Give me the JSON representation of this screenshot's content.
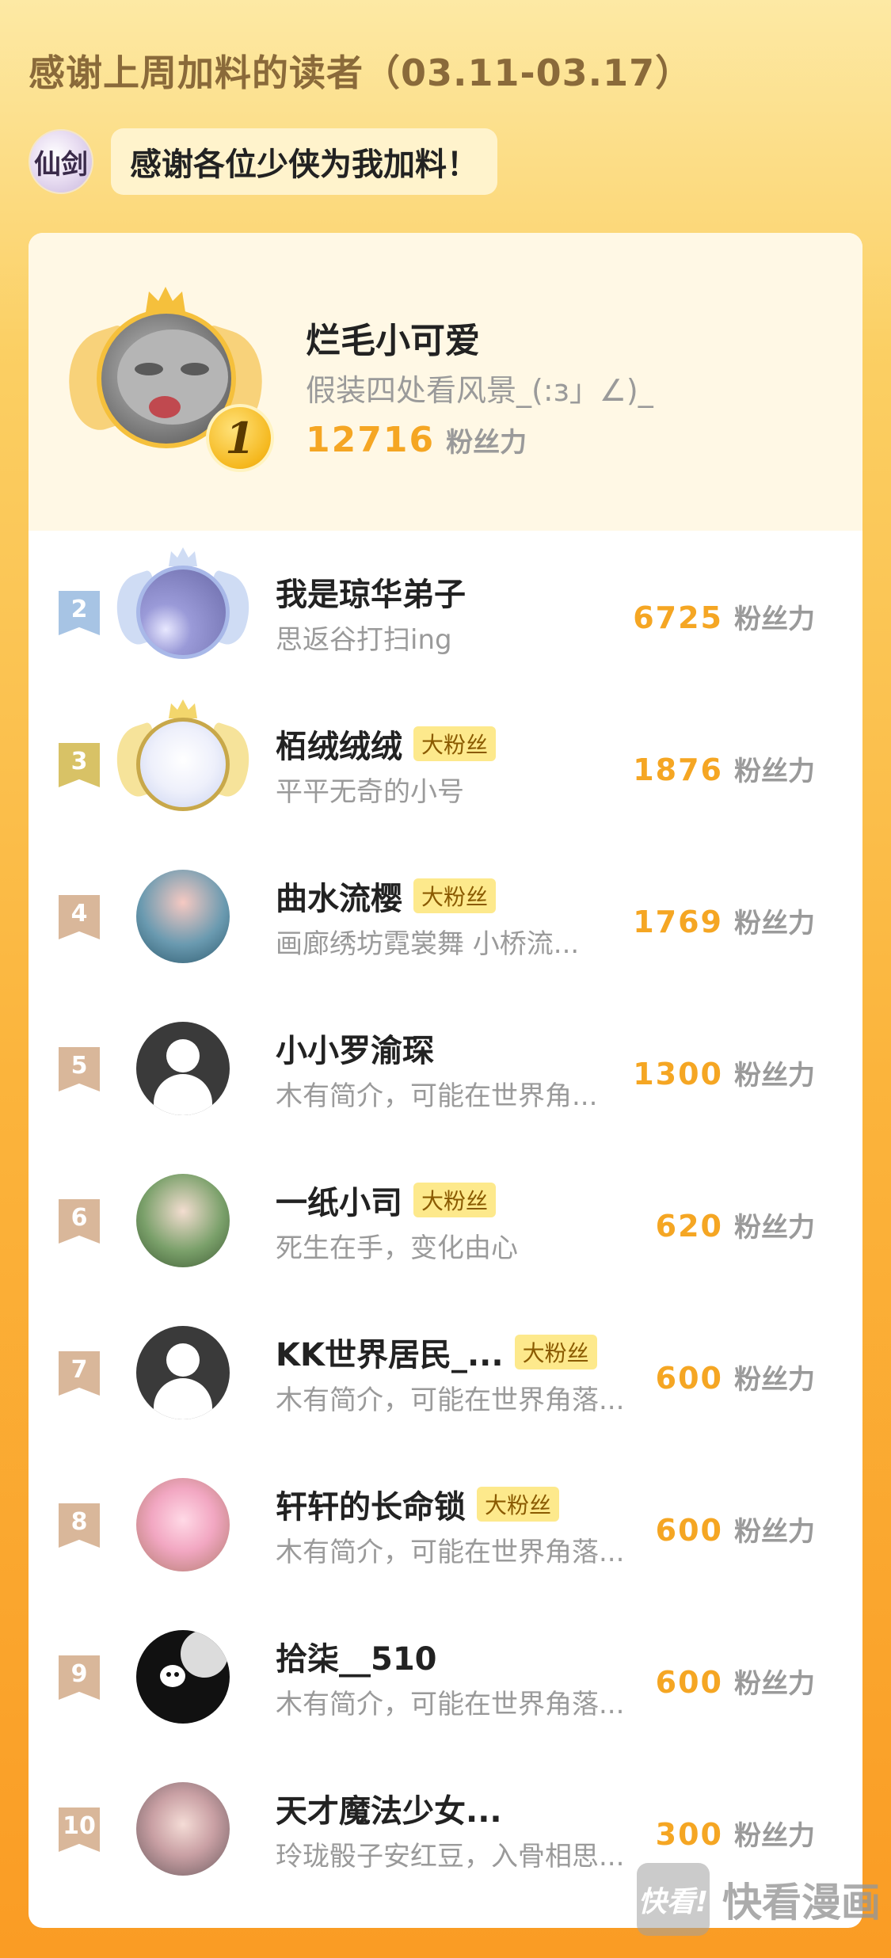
{
  "header": {
    "title": "感谢上周加料的读者（03.11-03.17）"
  },
  "author": {
    "avatar_text": "仙剑",
    "message": "感谢各位少侠为我加料！"
  },
  "colors": {
    "accent_score": "#f5a623",
    "badge_bg": "#fde98c",
    "rank2": "#a7c4e4",
    "rank3": "#d8c266",
    "rank_other": "#d9b79a"
  },
  "top_fan": {
    "rank": "1",
    "name": "烂毛小可爱",
    "bio": "假装四处看风景_(:з」∠)_",
    "score": "12716",
    "unit": "粉丝力"
  },
  "fans": [
    {
      "rank": "2",
      "name": "我是琼华弟子",
      "badge": "",
      "bio": "思返谷打扫ing",
      "score": "6725",
      "unit": "粉丝力"
    },
    {
      "rank": "3",
      "name": "栢绒绒绒",
      "badge": "大粉丝",
      "bio": "平平无奇的小号",
      "score": "1876",
      "unit": "粉丝力"
    },
    {
      "rank": "4",
      "name": "曲水流樱",
      "badge": "大粉丝",
      "bio": "画廊绣坊霓裳舞 小桥流...",
      "score": "1769",
      "unit": "粉丝力"
    },
    {
      "rank": "5",
      "name": "小小罗渝琛",
      "badge": "",
      "bio": "木有简介，可能在世界角...",
      "score": "1300",
      "unit": "粉丝力"
    },
    {
      "rank": "6",
      "name": "一纸小司",
      "badge": "大粉丝",
      "bio": "死生在手，变化由心",
      "score": "620",
      "unit": "粉丝力"
    },
    {
      "rank": "7",
      "name": "KK世界居民_...",
      "badge": "大粉丝",
      "bio": "木有简介，可能在世界角落...",
      "score": "600",
      "unit": "粉丝力"
    },
    {
      "rank": "8",
      "name": "轩轩的长命锁",
      "badge": "大粉丝",
      "bio": "木有简介，可能在世界角落...",
      "score": "600",
      "unit": "粉丝力"
    },
    {
      "rank": "9",
      "name": "拾柒__510",
      "badge": "",
      "bio": "木有简介，可能在世界角落...",
      "score": "600",
      "unit": "粉丝力"
    },
    {
      "rank": "10",
      "name": "天才魔法少女...",
      "badge": "",
      "bio": "玲珑骰子安红豆，入骨相思...",
      "score": "300",
      "unit": "粉丝力"
    }
  ],
  "watermark": {
    "logo_text": "快看!",
    "text": "快看漫画"
  }
}
